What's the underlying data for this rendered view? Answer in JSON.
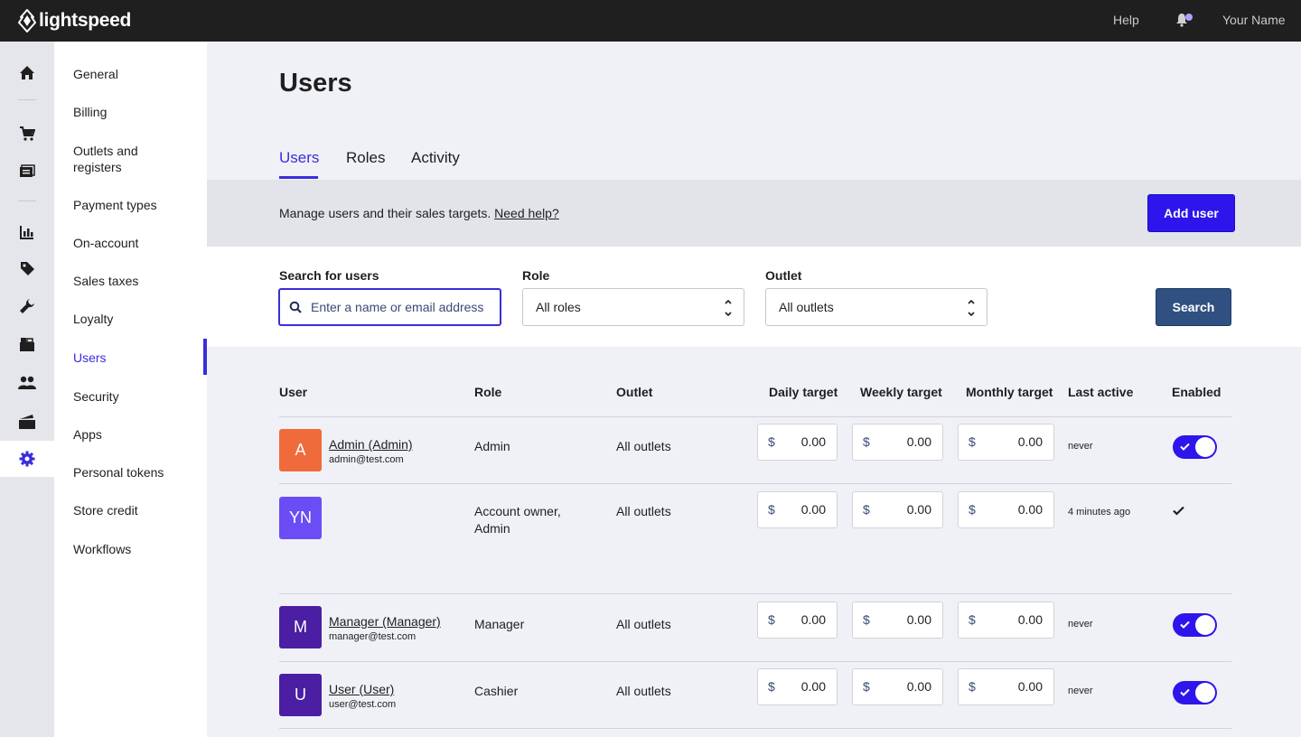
{
  "brand": {
    "name": "lightspeed"
  },
  "topbar": {
    "help": "Help",
    "user_name": "Your Name"
  },
  "rail": [
    "home-icon",
    "cart-icon",
    "register-icon",
    "reports-icon",
    "tag-icon",
    "wrench-icon",
    "inventory-icon",
    "customers-icon",
    "ecommerce-icon",
    "settings-icon"
  ],
  "subnav": {
    "items": [
      "General",
      "Billing",
      "Outlets and registers",
      "Payment types",
      "On-account",
      "Sales taxes",
      "Loyalty",
      "Users",
      "Security",
      "Apps",
      "Personal tokens",
      "Store credit",
      "Workflows"
    ],
    "active": "Users"
  },
  "page": {
    "title": "Users",
    "tabs": [
      "Users",
      "Roles",
      "Activity"
    ],
    "active_tab": "Users"
  },
  "info": {
    "text": "Manage users and their sales targets. ",
    "link": "Need help?",
    "add_button": "Add user"
  },
  "filters": {
    "search_label": "Search for users",
    "search_placeholder": "Enter a name or email address",
    "role_label": "Role",
    "role_value": "All roles",
    "outlet_label": "Outlet",
    "outlet_value": "All outlets",
    "search_button": "Search"
  },
  "table": {
    "headers": [
      "User",
      "Role",
      "Outlet",
      "Daily target",
      "Weekly target",
      "Monthly target",
      "Last active",
      "Enabled"
    ],
    "currency": "$",
    "rows": [
      {
        "initials": "A",
        "color": "#ef6b3b",
        "name": "Admin (Admin)",
        "email": "admin@test.com",
        "role": "Admin",
        "outlet": "All outlets",
        "daily": "0.00",
        "weekly": "0.00",
        "monthly": "0.00",
        "last_active": "never",
        "enabled": "toggle-on"
      },
      {
        "initials": "YN",
        "color": "#6b4cf5",
        "name": "",
        "email": "",
        "role": "Account owner, Admin",
        "outlet": "All outlets",
        "daily": "0.00",
        "weekly": "0.00",
        "monthly": "0.00",
        "last_active": "4 minutes ago",
        "enabled": "checkmark"
      },
      {
        "initials": "M",
        "color": "#4b1ea3",
        "name": "Manager (Manager)",
        "email": "manager@test.com",
        "role": "Manager",
        "outlet": "All outlets",
        "daily": "0.00",
        "weekly": "0.00",
        "monthly": "0.00",
        "last_active": "never",
        "enabled": "toggle-on"
      },
      {
        "initials": "U",
        "color": "#4b1ea3",
        "name": "User (User)",
        "email": "user@test.com",
        "role": "Cashier",
        "outlet": "All outlets",
        "daily": "0.00",
        "weekly": "0.00",
        "monthly": "0.00",
        "last_active": "never",
        "enabled": "toggle-on"
      }
    ]
  },
  "colors": {
    "accent": "#2e15ec",
    "active_nav": "#3a2ddb",
    "search_button": "#2f5080",
    "topbar": "#1f1f1f"
  }
}
